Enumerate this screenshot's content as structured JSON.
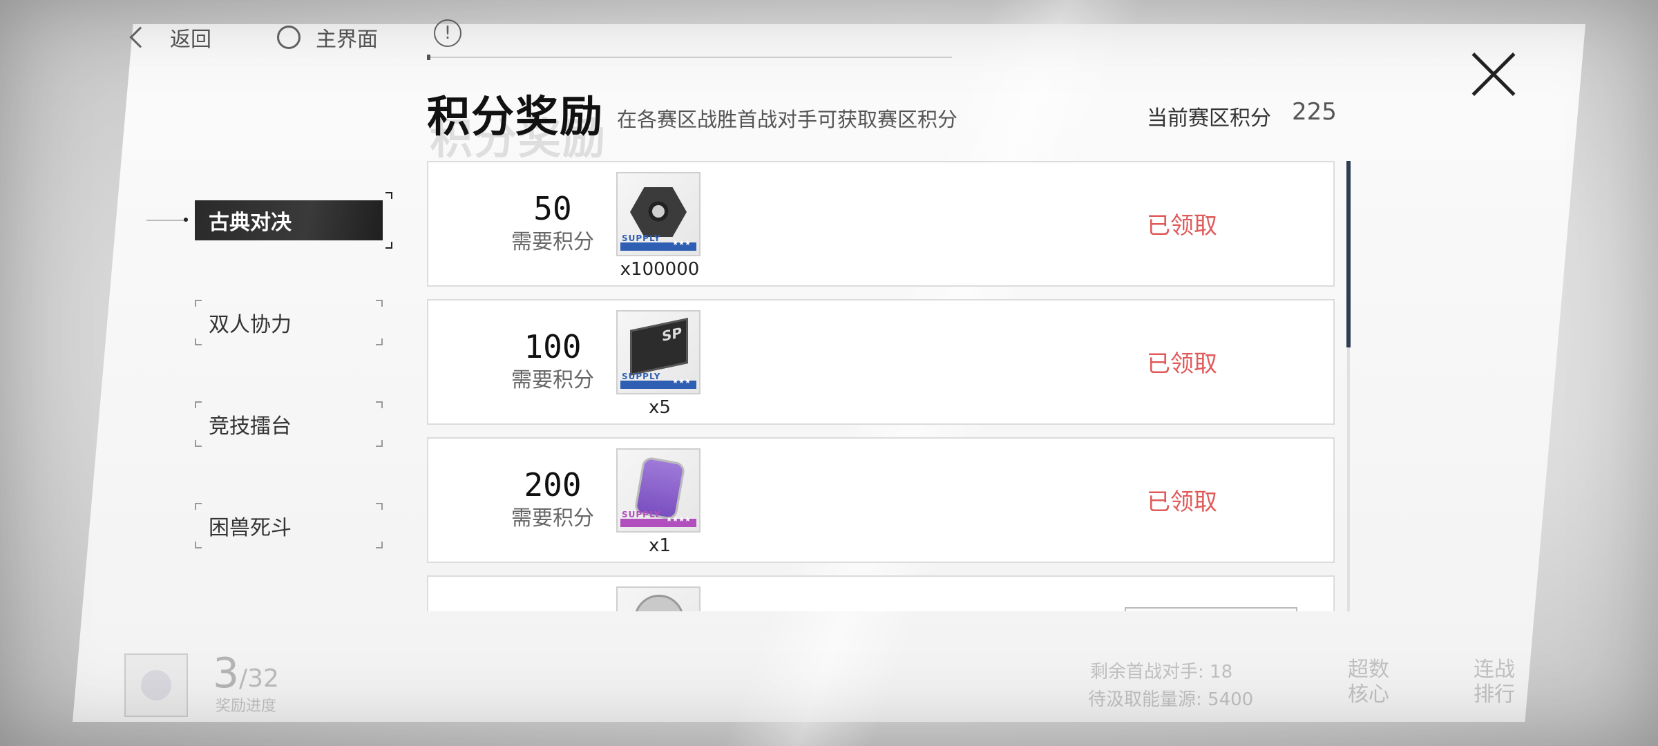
{
  "topbar": {
    "back_label": "返回",
    "home_label": "主界面",
    "info_glyph": "!"
  },
  "header": {
    "title": "积分奖励",
    "subtitle": "在各赛区战胜首战对手可获取赛区积分",
    "points_label": "当前赛区积分",
    "points_value": "225"
  },
  "tabs": [
    {
      "label": "古典对决",
      "active": true
    },
    {
      "label": "双人协力",
      "active": false
    },
    {
      "label": "竞技擂台",
      "active": false
    },
    {
      "label": "困兽死斗",
      "active": false
    }
  ],
  "rewards": [
    {
      "required": "50",
      "required_label": "需要积分",
      "item_icon": "hex-nut-icon",
      "item_tier": "SUPPLY",
      "qty": "x100000",
      "status": "已领取",
      "color": "#2f5fb3"
    },
    {
      "required": "100",
      "required_label": "需要积分",
      "item_icon": "sp-chip-icon",
      "item_tier": "SUPPLY",
      "qty": "x5",
      "status": "已领取",
      "color": "#2f5fb3"
    },
    {
      "required": "200",
      "required_label": "需要积分",
      "item_icon": "energy-capsule-icon",
      "item_tier": "SUPPLY",
      "qty": "x1",
      "status": "已领取",
      "color": "#b24fbf"
    },
    {
      "required": "",
      "required_label": "",
      "item_icon": "coin-icon",
      "item_tier": "",
      "qty": "",
      "status": ""
    }
  ],
  "bottom": {
    "progress_current": "3",
    "progress_total": "/32",
    "progress_label": "奖励进度",
    "stat_line1": "剩余首战对手: 18",
    "stat_line2": "待汲取能量源: 5400",
    "btn_core": "超数\n核心",
    "btn_rank": "连战\n排行"
  },
  "colors": {
    "claimed": "#e05a5a",
    "accent_dark": "#2f3d52"
  }
}
